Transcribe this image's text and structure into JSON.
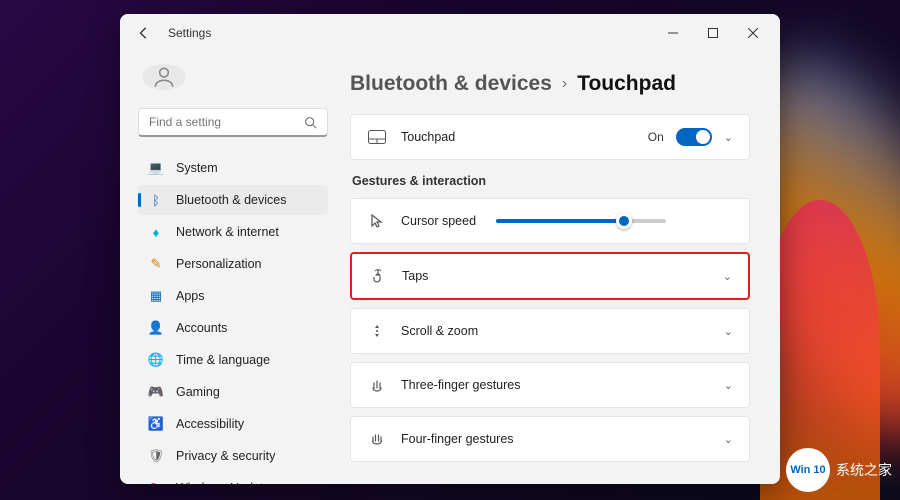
{
  "window": {
    "title": "Settings"
  },
  "search": {
    "placeholder": "Find a setting"
  },
  "nav": {
    "items": [
      {
        "label": "System",
        "icon": "💻",
        "color": "#0067c0"
      },
      {
        "label": "Bluetooth & devices",
        "icon": "ᛒ",
        "color": "#0067c0"
      },
      {
        "label": "Network & internet",
        "icon": "♦",
        "color": "#00b0d0"
      },
      {
        "label": "Personalization",
        "icon": "✎",
        "color": "#d08000"
      },
      {
        "label": "Apps",
        "icon": "▦",
        "color": "#0067c0"
      },
      {
        "label": "Accounts",
        "icon": "👤",
        "color": "#d08050"
      },
      {
        "label": "Time & language",
        "icon": "🌐",
        "color": "#0090d0"
      },
      {
        "label": "Gaming",
        "icon": "🎮",
        "color": "#666"
      },
      {
        "label": "Accessibility",
        "icon": "♿",
        "color": "#0067c0"
      },
      {
        "label": "Privacy & security",
        "icon": "🛡",
        "color": "#666"
      },
      {
        "label": "Windows Update",
        "icon": "↻",
        "color": "#00a0c0"
      }
    ],
    "active_index": 1
  },
  "breadcrumb": {
    "parent": "Bluetooth & devices",
    "current": "Touchpad"
  },
  "touchpad_card": {
    "label": "Touchpad",
    "state_label": "On",
    "on": true
  },
  "section_heading": "Gestures & interaction",
  "rows": [
    {
      "label": "Cursor speed",
      "kind": "slider",
      "value": 75
    },
    {
      "label": "Taps",
      "kind": "expand",
      "highlighted": true
    },
    {
      "label": "Scroll & zoom",
      "kind": "expand"
    },
    {
      "label": "Three-finger gestures",
      "kind": "expand"
    },
    {
      "label": "Four-finger gestures",
      "kind": "expand"
    }
  ],
  "watermark": {
    "badge": "Win 10",
    "text": "系统之家"
  }
}
